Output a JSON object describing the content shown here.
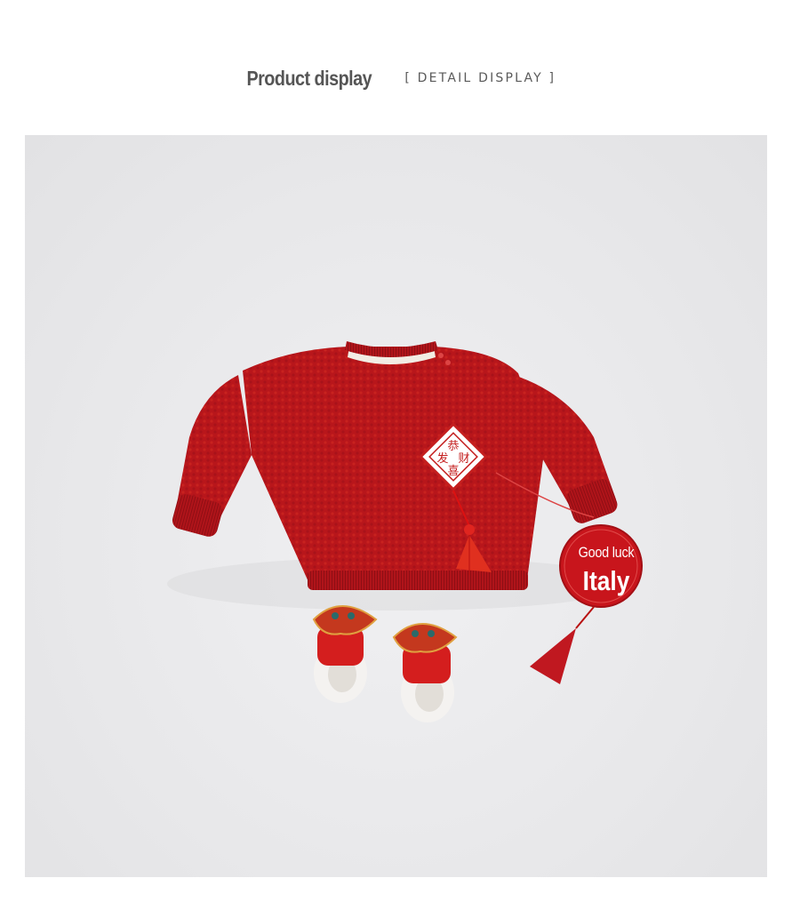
{
  "header": {
    "title": "Product display",
    "subtitle": "[ DETAIL DISPLAY ]"
  },
  "photo": {
    "subject": "red-fleece-sweater-with-tiger-shoes",
    "tag": {
      "line1": "Good luck",
      "line2": "Italy"
    },
    "colors": {
      "garment": "#b8151a",
      "background": "#ececee"
    }
  }
}
